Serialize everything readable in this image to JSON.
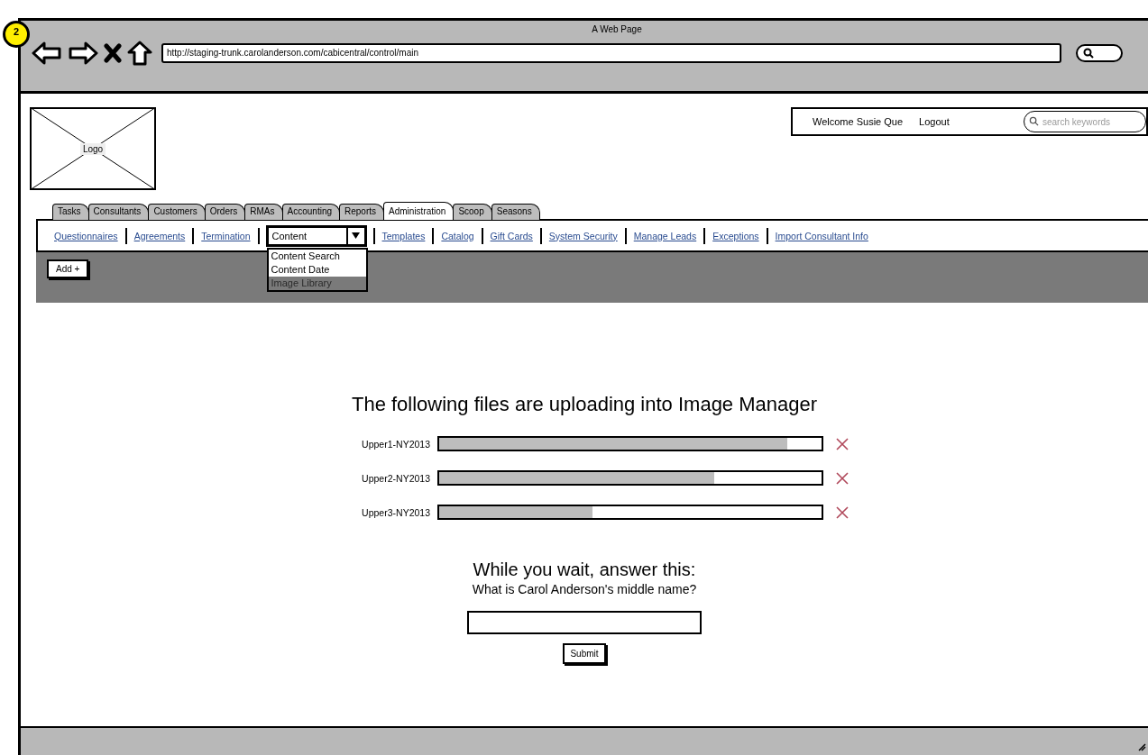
{
  "window": {
    "badge": "2",
    "title": "A Web Page",
    "url": "http://staging-trunk.carolanderson.com/cabicentral/control/main"
  },
  "header": {
    "logo": "Logo",
    "welcome": "Welcome Susie Que",
    "logout": "Logout",
    "search_placeholder": "search keywords"
  },
  "tabs": [
    {
      "label": "Tasks",
      "selected": false
    },
    {
      "label": "Consultants",
      "selected": false
    },
    {
      "label": "Customers",
      "selected": false
    },
    {
      "label": "Orders",
      "selected": false
    },
    {
      "label": "RMAs",
      "selected": false
    },
    {
      "label": "Accounting",
      "selected": false
    },
    {
      "label": "Reports",
      "selected": false
    },
    {
      "label": "Administration",
      "selected": true
    },
    {
      "label": "Scoop",
      "selected": false
    },
    {
      "label": "Seasons",
      "selected": false
    }
  ],
  "subnav": [
    {
      "kind": "link",
      "label": "Questionnaires"
    },
    {
      "kind": "link",
      "label": "Agreements"
    },
    {
      "kind": "link",
      "label": "Termination"
    },
    {
      "kind": "dropdown",
      "value": "Content",
      "expanded": true,
      "options": [
        {
          "label": "Content Search",
          "selected": false
        },
        {
          "label": "Content Date",
          "selected": false
        },
        {
          "label": "Image Library",
          "selected": true
        }
      ]
    },
    {
      "kind": "link",
      "label": "Templates"
    },
    {
      "kind": "link",
      "label": "Catalog"
    },
    {
      "kind": "link",
      "label": "Gift Cards"
    },
    {
      "kind": "link",
      "label": "System Security"
    },
    {
      "kind": "link",
      "label": "Manage Leads"
    },
    {
      "kind": "link",
      "label": "Exceptions"
    },
    {
      "kind": "link",
      "label": "Import Consultant Info"
    }
  ],
  "toolbar": {
    "add_button": "Add +"
  },
  "upload": {
    "heading": "The following files are uploading into Image Manager",
    "files": [
      {
        "name": "Upper1-NY2013",
        "level": 0.91
      },
      {
        "name": "Upper2-NY2013",
        "level": 0.72
      },
      {
        "name": "Upper3-NY2013",
        "level": 0.4
      }
    ]
  },
  "quiz": {
    "title": "While you wait, answer this:",
    "question": "What is Carol Anderson's middle name?",
    "submit": "Submit"
  }
}
